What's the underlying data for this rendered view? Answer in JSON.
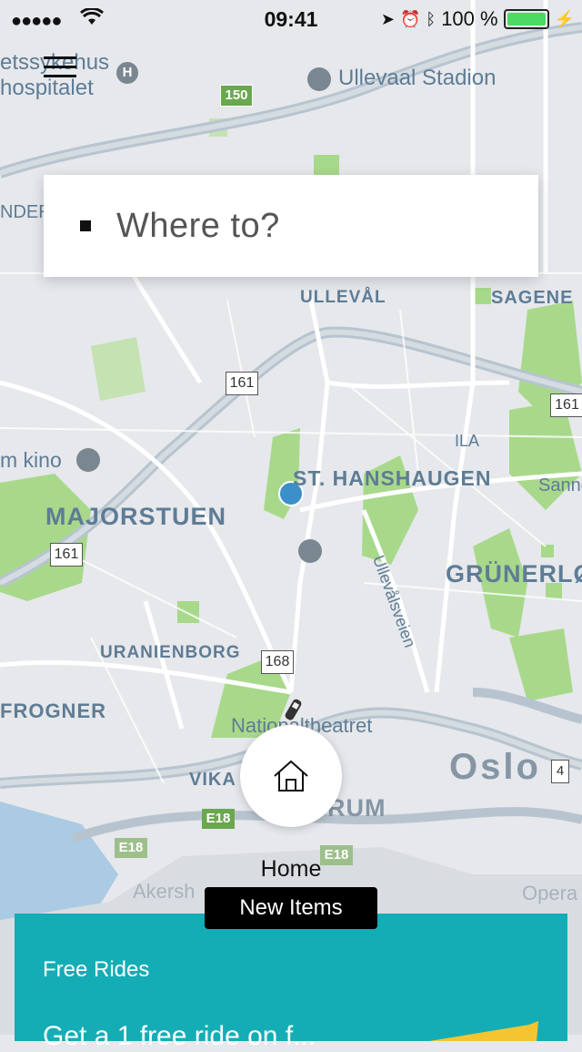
{
  "status_bar": {
    "signal": "●●●●●",
    "time": "09:41",
    "battery_percent": "100 %"
  },
  "search": {
    "placeholder": "Where to?"
  },
  "map": {
    "labels": {
      "hospital": "etssykehus\nhospitalet",
      "ullevaal_stadion": "Ullevaal Stadion",
      "ullevaal": "ULLEVÅL",
      "sagene": "SAGENE",
      "st_hanshaugen": "ST. HANSHAUGEN",
      "majorstuen": "MAJORSTUEN",
      "grunerlokka": "GRÜNERLØ",
      "uranienborg": "URANIENBORG",
      "frogner": "FROGNER",
      "nationaltheatret": "Nationaltheatret",
      "vika": "VIKA",
      "sentrum": "RUM",
      "oslo": "Oslo",
      "kino": "m kino",
      "ila": "ILA",
      "sannergata": "Sanne",
      "ullevalsveien": "Ullevålsveien",
      "under": "NDER",
      "aker": "Akersh",
      "opera": "Opera"
    },
    "road_numbers": [
      "150",
      "161",
      "161",
      "161",
      "168",
      "E18",
      "E18",
      "E18",
      "4"
    ]
  },
  "home": {
    "label": "Home"
  },
  "new_items": {
    "label": "New Items"
  },
  "promo": {
    "title": "Free Rides",
    "subtitle": "Get a 1 free ride on f..."
  },
  "colors": {
    "accent_teal": "#14adb5",
    "park_green": "#a8d98b",
    "map_bg": "#e6e8ec",
    "road": "#ffffff",
    "major_road": "#a9b9c6"
  }
}
